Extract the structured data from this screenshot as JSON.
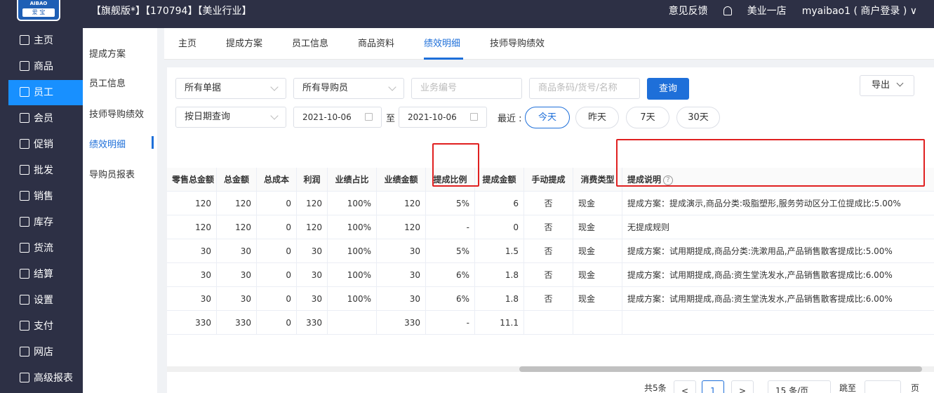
{
  "logo": {
    "line1": "AIBAO",
    "line2": "爱 宝"
  },
  "header": {
    "title": "【旗舰版*】【170794】【美业行业】",
    "feedback": "意见反馈",
    "store": "美业一店",
    "user": "myaibao1 ( 商户登录 )"
  },
  "sidebar": {
    "items": [
      {
        "label": "主页",
        "icon": "home-icon"
      },
      {
        "label": "商品",
        "icon": "product-icon"
      },
      {
        "label": "员工",
        "icon": "staff-icon"
      },
      {
        "label": "会员",
        "icon": "member-icon"
      },
      {
        "label": "促销",
        "icon": "promo-icon"
      },
      {
        "label": "批发",
        "icon": "wholesale-icon"
      },
      {
        "label": "销售",
        "icon": "sales-icon"
      },
      {
        "label": "库存",
        "icon": "stock-icon"
      },
      {
        "label": "货流",
        "icon": "flow-icon"
      },
      {
        "label": "结算",
        "icon": "settle-icon"
      },
      {
        "label": "设置",
        "icon": "gear-icon"
      },
      {
        "label": "支付",
        "icon": "pay-icon"
      },
      {
        "label": "网店",
        "icon": "shop-icon"
      },
      {
        "label": "高级报表",
        "icon": "report-icon"
      }
    ],
    "active": "员工"
  },
  "subnav": {
    "items": [
      "提成方案",
      "员工信息",
      "技师导购绩效",
      "绩效明细",
      "导购员报表"
    ],
    "active": "绩效明细"
  },
  "tabs": [
    "主页",
    "提成方案",
    "员工信息",
    "商品资料",
    "绩效明细",
    "技师导购绩效"
  ],
  "active_tab": "绩效明细",
  "filters": {
    "doc_select": "所有单据",
    "guide_select": "所有导购员",
    "biz_no_placeholder": "业务编号",
    "goods_placeholder": "商品条码/货号/名称",
    "query_label": "查询",
    "export_label": "导出",
    "date_mode": "按日期查询",
    "date_from": "2021-10-06",
    "to_label": "至",
    "date_to": "2021-10-06",
    "recent_label": "最近 :",
    "quick": [
      "今天",
      "昨天",
      "7天",
      "30天"
    ],
    "quick_active": "今天"
  },
  "table": {
    "columns": [
      "零售总金额",
      "总金额",
      "总成本",
      "利润",
      "业绩占比",
      "业绩金额",
      "提成比例",
      "提成金额",
      "手动提成",
      "消费类型",
      "提成说明"
    ],
    "rows": [
      [
        "120",
        "120",
        "0",
        "120",
        "100%",
        "120",
        "5%",
        "6",
        "否",
        "现金",
        "提成方案：提成演示,商品分类:吸脂塑形,服务劳动区分工位提成比:5.00%"
      ],
      [
        "120",
        "120",
        "0",
        "120",
        "100%",
        "120",
        "-",
        "0",
        "否",
        "现金",
        "无提成规则"
      ],
      [
        "30",
        "30",
        "0",
        "30",
        "100%",
        "30",
        "5%",
        "1.5",
        "否",
        "现金",
        "提成方案：试用期提成,商品分类:洗漱用品,产品销售散客提成比:5.00%"
      ],
      [
        "30",
        "30",
        "0",
        "30",
        "100%",
        "30",
        "6%",
        "1.8",
        "否",
        "现金",
        "提成方案：试用期提成,商品:资生堂洗发水,产品销售散客提成比:6.00%"
      ],
      [
        "30",
        "30",
        "0",
        "30",
        "100%",
        "30",
        "6%",
        "1.8",
        "否",
        "现金",
        "提成方案：试用期提成,商品:资生堂洗发水,产品销售散客提成比:6.00%"
      ]
    ],
    "total": [
      "330",
      "330",
      "0",
      "330",
      "",
      "330",
      "-",
      "11.1",
      "",
      "",
      ""
    ]
  },
  "pager": {
    "total": "共5条",
    "prev": "<",
    "page": "1",
    "next": ">",
    "size": "15 条/页",
    "goto": "跳至",
    "page_unit": "页"
  }
}
